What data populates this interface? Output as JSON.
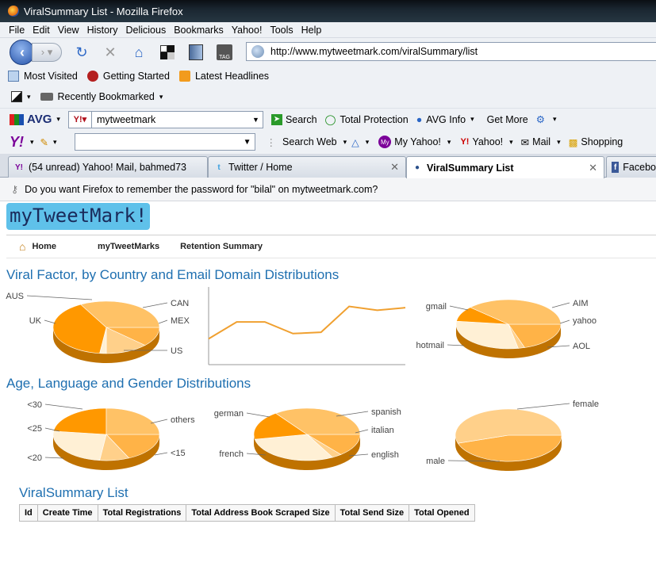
{
  "window": {
    "title": "ViralSummary List - Mozilla Firefox"
  },
  "menu": [
    "File",
    "Edit",
    "View",
    "History",
    "Delicious",
    "Bookmarks",
    "Yahoo!",
    "Tools",
    "Help"
  ],
  "nav": {
    "url": "http://www.mytweetmark.com/viralSummary/list"
  },
  "bookmarks": [
    "Most Visited",
    "Getting Started",
    "Latest Headlines"
  ],
  "recent": "Recently Bookmarked",
  "avg": {
    "logo": "AVG",
    "search_value": "mytweetmark",
    "search_label": "Search",
    "protection": "Total Protection",
    "info": "AVG Info",
    "more": "Get More"
  },
  "yahoo": {
    "search_web": "Search Web",
    "my_yahoo": "My Yahoo!",
    "yahoo": "Yahoo!",
    "mail": "Mail",
    "shopping": "Shopping"
  },
  "tabs": [
    {
      "label": "(54 unread) Yahoo! Mail, bahmed73"
    },
    {
      "label": "Twitter / Home"
    },
    {
      "label": "ViralSummary List"
    },
    {
      "label": "Facebo"
    }
  ],
  "notify": "Do you want Firefox to remember the password for \"bilal\" on mytweetmark.com?",
  "site": {
    "logo": "myTweetMark!",
    "nav": [
      "Home",
      "myTweetMarks",
      "Retention Summary"
    ]
  },
  "section1": "Viral Factor, by Country and Email Domain Distributions",
  "section2": "Age, Language and Gender Distributions",
  "list_title": "ViralSummary List",
  "table_headers": [
    "Id",
    "Create Time",
    "Total Registrations",
    "Total Address Book Scraped Size",
    "Total Send Size",
    "Total Opened"
  ],
  "chart_data": [
    {
      "type": "pie",
      "labels": [
        "AUS",
        "CAN",
        "MEX",
        "US",
        "UK"
      ],
      "values": [
        12,
        13,
        2,
        40,
        33
      ]
    },
    {
      "type": "line",
      "values": [
        20,
        33,
        33,
        24,
        25,
        45,
        42,
        44
      ]
    },
    {
      "type": "pie",
      "labels": [
        "gmail",
        "AIM",
        "yahoo",
        "AOL",
        "hotmail"
      ],
      "values": [
        20,
        2,
        30,
        10,
        38
      ]
    },
    {
      "type": "pie",
      "labels": [
        "<30",
        "others",
        "<15",
        "<20",
        "<25"
      ],
      "values": [
        18,
        9,
        25,
        23,
        25
      ]
    },
    {
      "type": "pie",
      "labels": [
        "spanish",
        "italian",
        "english",
        "french",
        "german"
      ],
      "values": [
        14,
        3,
        30,
        18,
        35
      ]
    },
    {
      "type": "pie",
      "labels": [
        "female",
        "male"
      ],
      "values": [
        45,
        55
      ]
    }
  ],
  "colors": {
    "accent": "#1e6fb0",
    "pie": [
      "#ffb347",
      "#ffd08a",
      "#fff0d5",
      "#ff9800",
      "#ffc266"
    ]
  }
}
